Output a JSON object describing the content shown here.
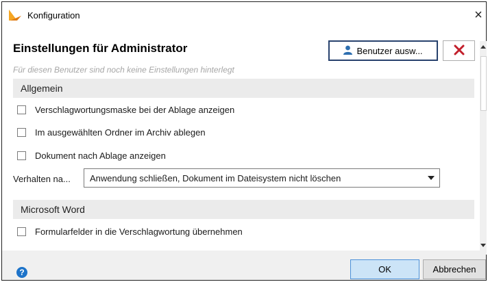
{
  "window": {
    "title": "Konfiguration",
    "close_glyph": "×"
  },
  "header": {
    "title": "Einstellungen für Administrator",
    "select_user_label": "Benutzer ausw...",
    "hint": "Für diesen Benutzer sind noch keine Einstellungen hinterlegt"
  },
  "sections": {
    "general": {
      "title": "Allgemein",
      "options": [
        {
          "label": "Verschlagwortungsmaske bei der Ablage anzeigen",
          "checked": false
        },
        {
          "label": "Im ausgewählten Ordner im Archiv ablegen",
          "checked": false
        },
        {
          "label": "Dokument nach Ablage anzeigen",
          "checked": false
        }
      ],
      "behavior": {
        "label": "Verhalten na...",
        "selected": "Anwendung schließen, Dokument im Dateisystem nicht löschen"
      }
    },
    "word": {
      "title": "Microsoft Word",
      "options": [
        {
          "label": "Formularfelder in die Verschlagwortung übernehmen",
          "checked": false
        }
      ]
    }
  },
  "footer": {
    "ok_label": "OK",
    "cancel_label": "Abbrechen"
  },
  "icons": {
    "app": "app-logo-icon",
    "user": "user-icon",
    "remove": "remove-icon",
    "dropdown": "chevron-down-icon",
    "help": "help-icon"
  },
  "colors": {
    "accent": "#1d73c9",
    "remove": "#c21f2b",
    "primary_button": "#cce4f7",
    "section_bg": "#ebebeb"
  }
}
